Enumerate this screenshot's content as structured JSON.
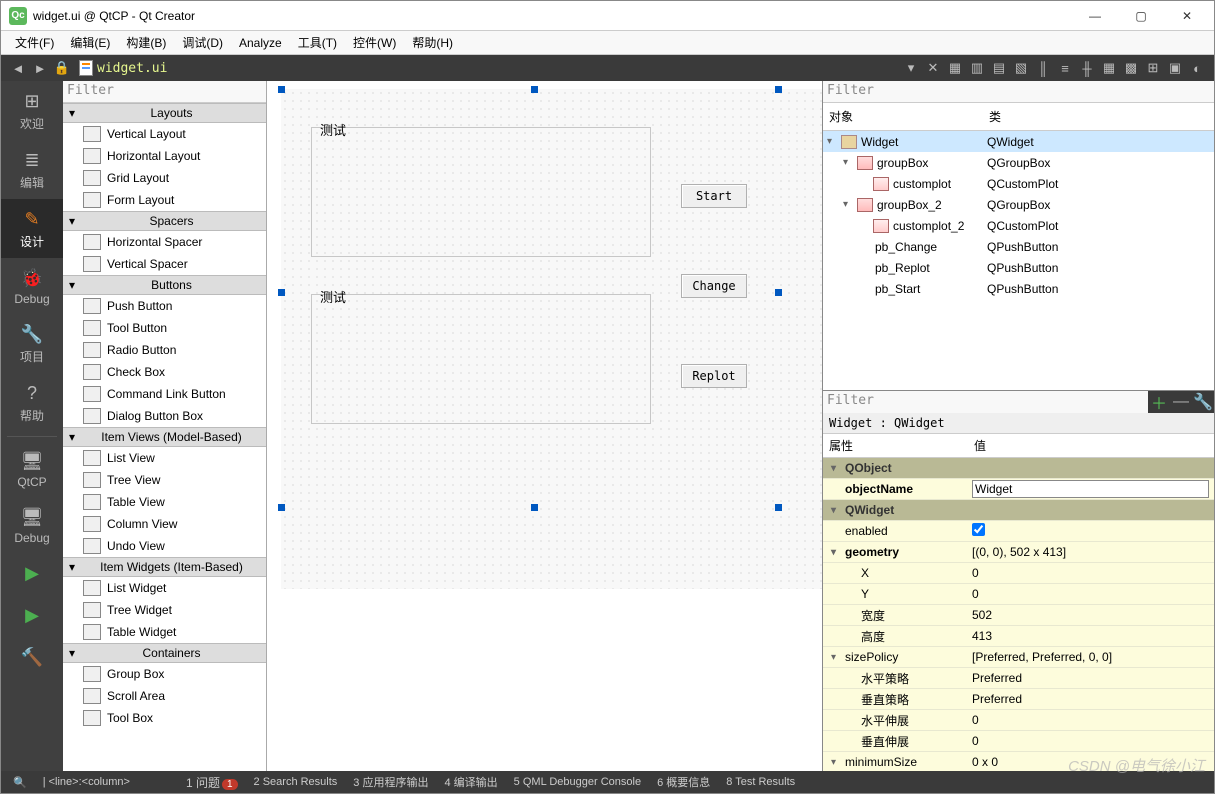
{
  "window": {
    "title": "widget.ui @ QtCP - Qt Creator"
  },
  "menus": [
    "文件(F)",
    "编辑(E)",
    "构建(B)",
    "调试(D)",
    "Analyze",
    "工具(T)",
    "控件(W)",
    "帮助(H)"
  ],
  "toolbar_file": "widget.ui",
  "sidebar": {
    "items": [
      {
        "label": "欢迎",
        "icon": "grid"
      },
      {
        "label": "编辑",
        "icon": "edit"
      },
      {
        "label": "设计",
        "icon": "pencil",
        "active": true
      },
      {
        "label": "Debug",
        "icon": "bug"
      },
      {
        "label": "项目",
        "icon": "wrench"
      },
      {
        "label": "帮助",
        "icon": "help"
      }
    ],
    "bottom": [
      {
        "label": "QtCP"
      },
      {
        "label": "Debug"
      }
    ]
  },
  "widgetbox": {
    "filter_placeholder": "Filter",
    "sections": [
      {
        "title": "Layouts",
        "items": [
          "Vertical Layout",
          "Horizontal Layout",
          "Grid Layout",
          "Form Layout"
        ]
      },
      {
        "title": "Spacers",
        "items": [
          "Horizontal Spacer",
          "Vertical Spacer"
        ]
      },
      {
        "title": "Buttons",
        "items": [
          "Push Button",
          "Tool Button",
          "Radio Button",
          "Check Box",
          "Command Link Button",
          "Dialog Button Box"
        ]
      },
      {
        "title": "Item Views (Model-Based)",
        "items": [
          "List View",
          "Tree View",
          "Table View",
          "Column View",
          "Undo View"
        ]
      },
      {
        "title": "Item Widgets (Item-Based)",
        "items": [
          "List Widget",
          "Tree Widget",
          "Table Widget"
        ]
      },
      {
        "title": "Containers",
        "items": [
          "Group Box",
          "Scroll Area",
          "Tool Box"
        ]
      }
    ]
  },
  "designer": {
    "group1_label": "测试",
    "group2_label": "测试",
    "buttons": {
      "start": "Start",
      "change": "Change",
      "replot": "Replot"
    }
  },
  "object_tree": {
    "filter_placeholder": "Filter",
    "headers": {
      "object": "对象",
      "class": "类"
    },
    "rows": [
      {
        "indent": 0,
        "chev": "v",
        "icon": "wid",
        "name": "Widget",
        "cls": "QWidget",
        "sel": true
      },
      {
        "indent": 1,
        "chev": "v",
        "icon": "grp",
        "name": "groupBox",
        "cls": "QGroupBox"
      },
      {
        "indent": 2,
        "chev": "",
        "icon": "plot",
        "name": "customplot",
        "cls": "QCustomPlot"
      },
      {
        "indent": 1,
        "chev": "v",
        "icon": "grp",
        "name": "groupBox_2",
        "cls": "QGroupBox"
      },
      {
        "indent": 2,
        "chev": "",
        "icon": "plot",
        "name": "customplot_2",
        "cls": "QCustomPlot"
      },
      {
        "indent": 1,
        "chev": "",
        "icon": "",
        "name": "pb_Change",
        "cls": "QPushButton"
      },
      {
        "indent": 1,
        "chev": "",
        "icon": "",
        "name": "pb_Replot",
        "cls": "QPushButton"
      },
      {
        "indent": 1,
        "chev": "",
        "icon": "",
        "name": "pb_Start",
        "cls": "QPushButton"
      }
    ]
  },
  "properties": {
    "filter_placeholder": "Filter",
    "crumb": "Widget : QWidget",
    "headers": {
      "prop": "属性",
      "val": "值"
    },
    "rows": [
      {
        "type": "group",
        "label": "QObject"
      },
      {
        "type": "edit",
        "label": "objectName",
        "value": "Widget",
        "bold": true
      },
      {
        "type": "group",
        "label": "QWidget"
      },
      {
        "type": "check",
        "label": "enabled",
        "value": true
      },
      {
        "type": "expand",
        "label": "geometry",
        "value": "[(0, 0), 502 x 413]",
        "bold": true
      },
      {
        "type": "sub",
        "label": "X",
        "value": "0"
      },
      {
        "type": "sub",
        "label": "Y",
        "value": "0"
      },
      {
        "type": "sub",
        "label": "宽度",
        "value": "502"
      },
      {
        "type": "sub",
        "label": "高度",
        "value": "413"
      },
      {
        "type": "expand",
        "label": "sizePolicy",
        "value": "[Preferred, Preferred, 0, 0]"
      },
      {
        "type": "sub",
        "label": "水平策略",
        "value": "Preferred"
      },
      {
        "type": "sub",
        "label": "垂直策略",
        "value": "Preferred"
      },
      {
        "type": "sub",
        "label": "水平伸展",
        "value": "0"
      },
      {
        "type": "sub",
        "label": "垂直伸展",
        "value": "0"
      },
      {
        "type": "expand",
        "label": "minimumSize",
        "value": "0 x 0"
      }
    ]
  },
  "statusbar": {
    "pos": "| <line>:<column>",
    "items": [
      "1 问题",
      "2 Search Results",
      "3 应用程序输出",
      "4 编译输出",
      "5 QML Debugger Console",
      "6 概要信息",
      "8 Test Results"
    ],
    "badge": "1"
  },
  "watermark": "CSDN @电气徐小江"
}
